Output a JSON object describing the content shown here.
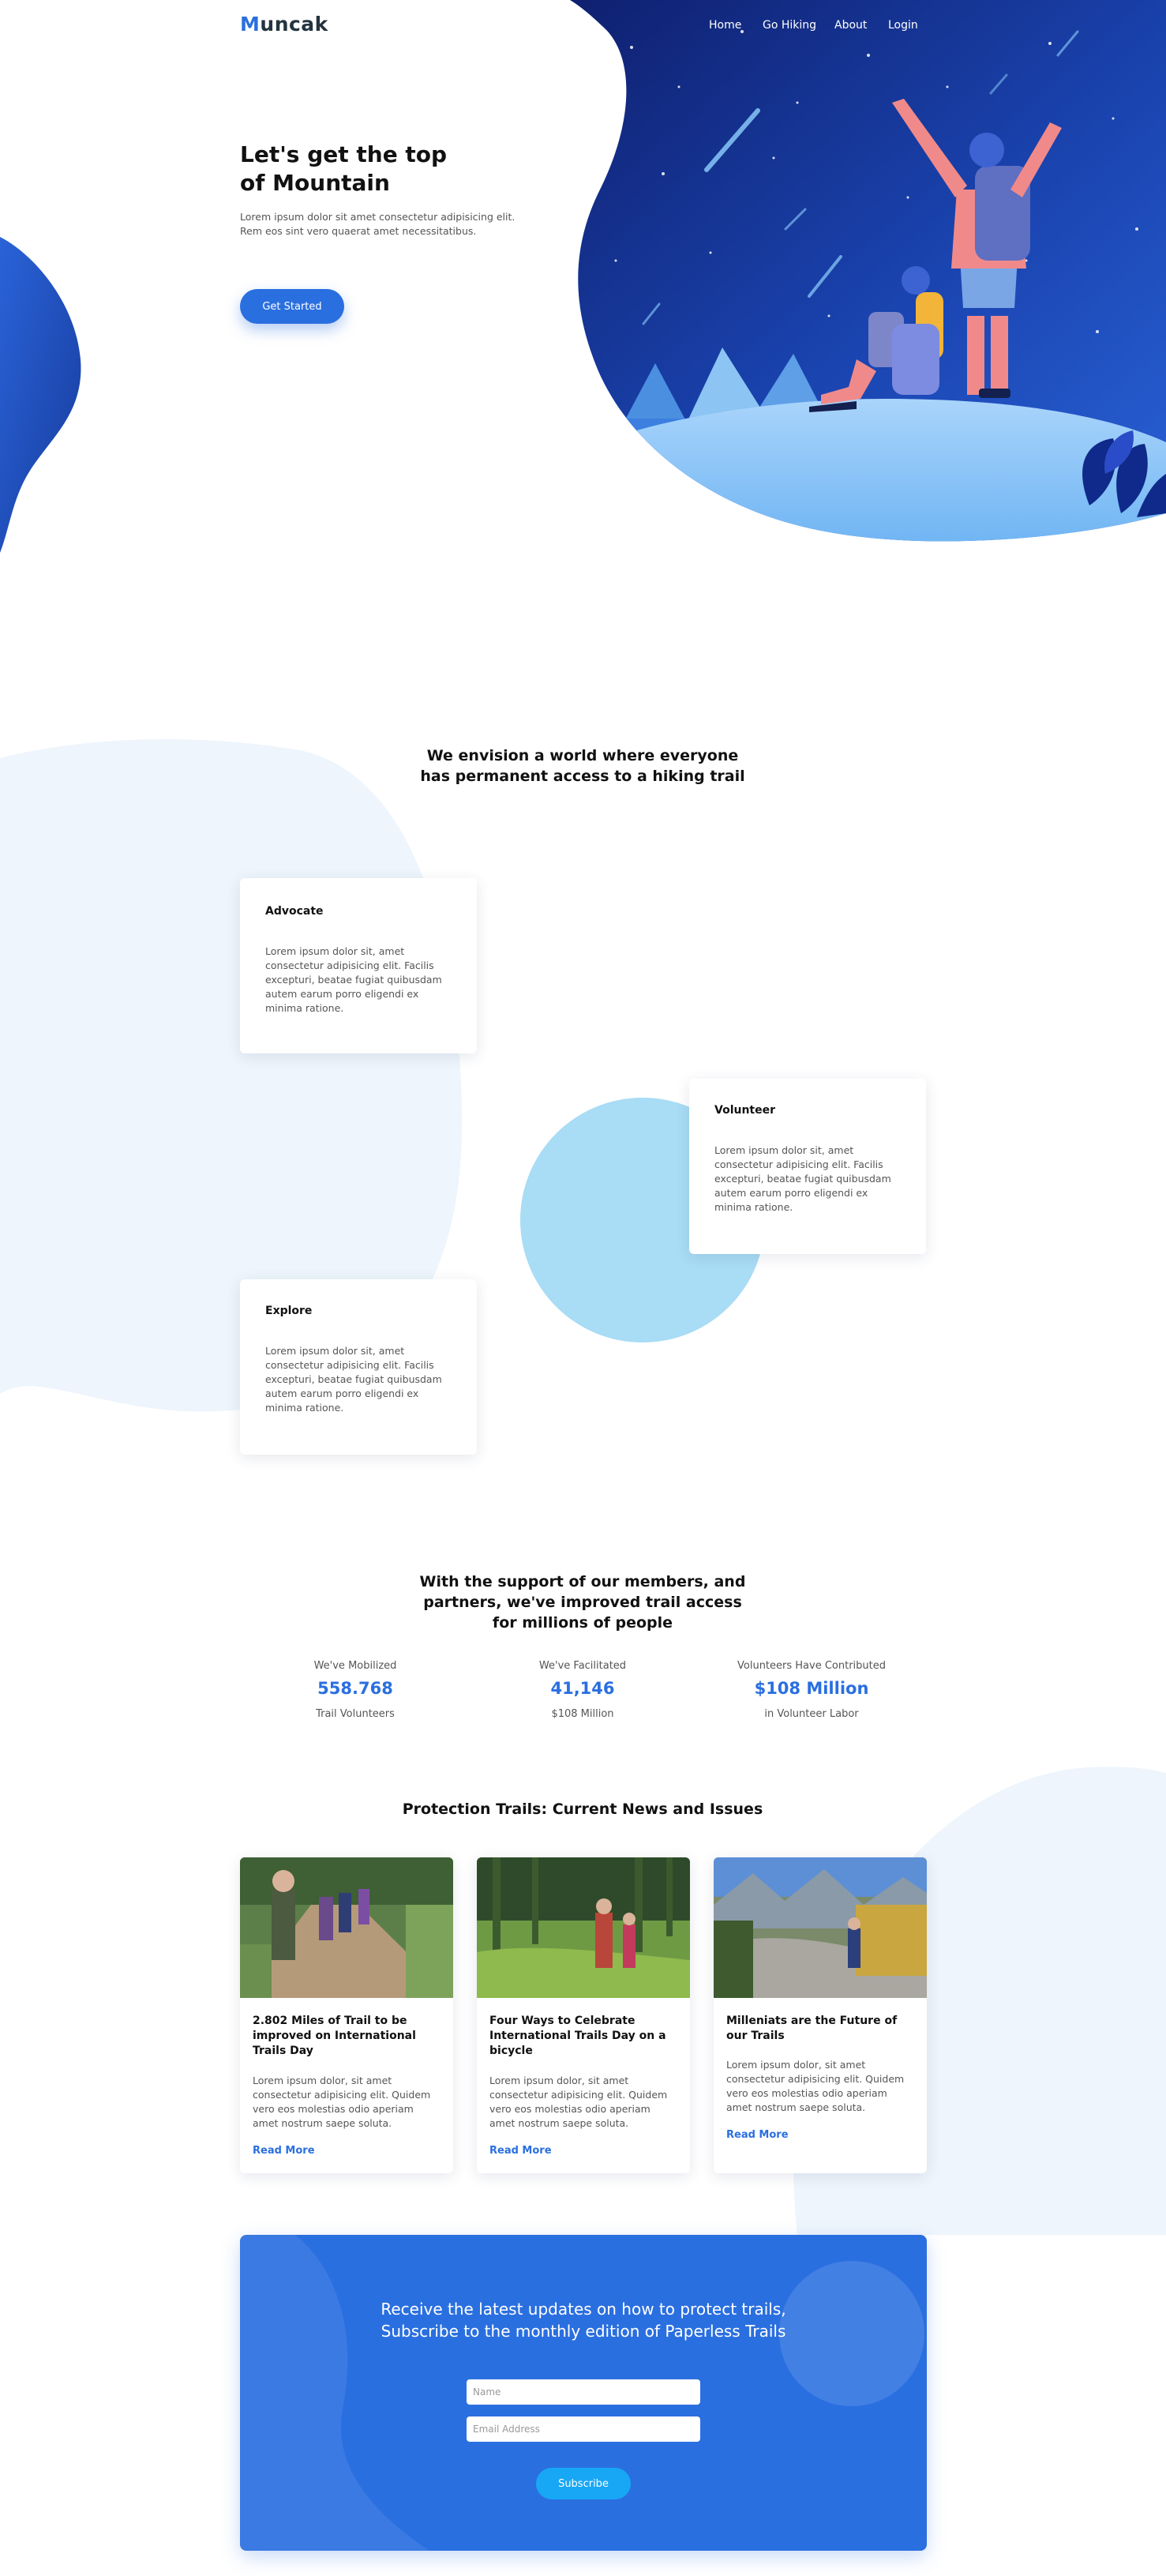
{
  "brand": {
    "first_letter": "M",
    "rest": "uncak"
  },
  "nav": {
    "items": [
      {
        "label": "Home"
      },
      {
        "label": "Go Hiking"
      },
      {
        "label": "About"
      },
      {
        "label": "Login"
      }
    ]
  },
  "hero": {
    "title": "Let's get the top of Mountain",
    "text": "Lorem ipsum dolor sit amet consectetur adipisicing elit. Rem eos sint vero quaerat amet necessitatibus.",
    "cta_label": "Get Started"
  },
  "vision": {
    "title": "We envision a world where everyone has permanent access to a hiking trail",
    "cards": [
      {
        "title": "Advocate",
        "text": "Lorem ipsum dolor sit, amet consectetur adipisicing elit. Facilis excepturi, beatae fugiat quibusdam autem earum porro eligendi ex minima ratione."
      },
      {
        "title": "Volunteer",
        "text": "Lorem ipsum dolor sit, amet consectetur adipisicing elit. Facilis excepturi, beatae fugiat quibusdam autem earum porro eligendi ex minima ratione."
      },
      {
        "title": "Explore",
        "text": "Lorem ipsum dolor sit, amet consectetur adipisicing elit. Facilis excepturi, beatae fugiat quibusdam autem earum porro eligendi ex minima ratione."
      }
    ]
  },
  "impact": {
    "title": "With the support of our members, and partners, we've improved trail access for millions of people",
    "stats": [
      {
        "label": "We've Mobilized",
        "value": "558.768",
        "sub": "Trail Volunteers"
      },
      {
        "label": "We've Facilitated",
        "value": "41,146",
        "sub": "$108 Million"
      },
      {
        "label": "Volunteers Have Contributed",
        "value": "$108 Million",
        "sub": "in Volunteer Labor"
      }
    ]
  },
  "news": {
    "title": "Protection Trails: Current News and Issues",
    "articles": [
      {
        "title": "2.802 Miles of Trail to be improved on International Trails Day",
        "text": "Lorem ipsum dolor, sit amet consectetur adipisicing elit. Quidem vero eos molestias odio aperiam amet nostrum saepe soluta.",
        "link": "Read More"
      },
      {
        "title": "Four Ways to Celebrate International Trails Day on a bicycle",
        "text": "Lorem ipsum dolor, sit amet consectetur adipisicing elit. Quidem vero eos molestias odio aperiam amet nostrum saepe soluta.",
        "link": "Read More"
      },
      {
        "title": "Milleniats are the Future of our Trails",
        "text": "Lorem ipsum dolor, sit amet consectetur adipisicing elit. Quidem vero eos molestias odio aperiam amet nostrum saepe soluta.",
        "link": "Read More"
      }
    ]
  },
  "subscribe": {
    "title": "Receive the latest updates on how to protect trails, Subscribe to the monthly edition of Paperless Trails",
    "name_placeholder": "Name",
    "email_placeholder": "Email Address",
    "button_label": "Subscribe"
  },
  "colors": {
    "accent": "#2a6fe0",
    "hero_blue": "#1b3fa8",
    "light_blue": "#a9dcf5",
    "bg_tint": "#eef5fc",
    "subscribe_button": "#18a7f5"
  }
}
